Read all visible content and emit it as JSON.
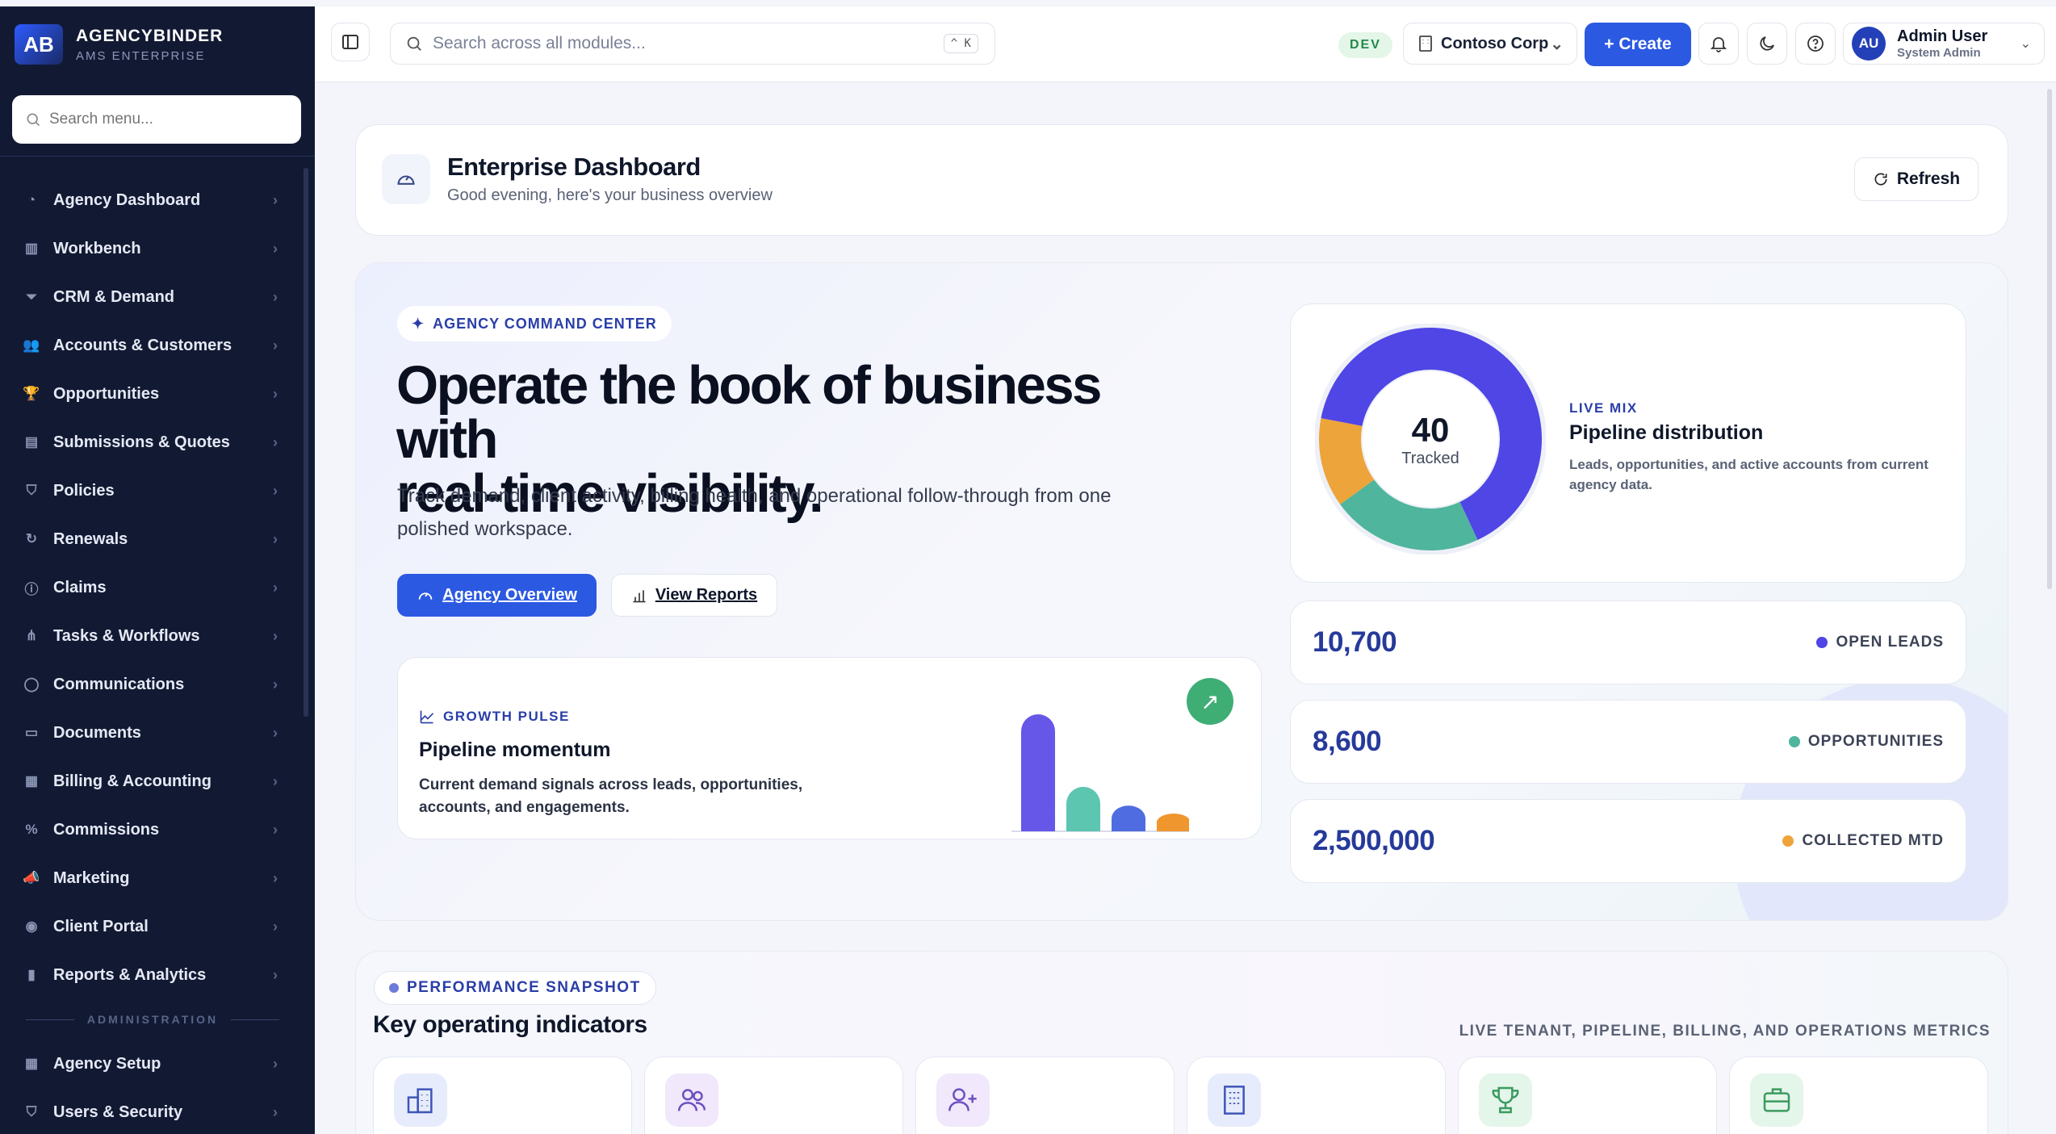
{
  "brand": {
    "name": "AGENCYBINDER",
    "sub": "AMS ENTERPRISE",
    "logo_text": "AB"
  },
  "sidebar": {
    "search_placeholder": "Search menu...",
    "items": [
      {
        "label": "Agency Dashboard",
        "icon": "gauge-icon"
      },
      {
        "label": "Workbench",
        "icon": "layout-icon"
      },
      {
        "label": "CRM & Demand",
        "icon": "funnel-icon"
      },
      {
        "label": "Accounts & Customers",
        "icon": "users-icon"
      },
      {
        "label": "Opportunities",
        "icon": "trophy-icon"
      },
      {
        "label": "Submissions & Quotes",
        "icon": "file-icon"
      },
      {
        "label": "Policies",
        "icon": "shield-icon"
      },
      {
        "label": "Renewals",
        "icon": "refresh-icon"
      },
      {
        "label": "Claims",
        "icon": "alert-icon"
      },
      {
        "label": "Tasks & Workflows",
        "icon": "workflow-icon"
      },
      {
        "label": "Communications",
        "icon": "message-icon"
      },
      {
        "label": "Documents",
        "icon": "folder-icon"
      },
      {
        "label": "Billing & Accounting",
        "icon": "ledger-icon"
      },
      {
        "label": "Commissions",
        "icon": "percent-icon"
      },
      {
        "label": "Marketing",
        "icon": "megaphone-icon"
      },
      {
        "label": "Client Portal",
        "icon": "user-circle-icon"
      },
      {
        "label": "Reports & Analytics",
        "icon": "bar-chart-icon"
      }
    ],
    "admin_label": "ADMINISTRATION",
    "admin_items": [
      {
        "label": "Agency Setup",
        "icon": "building-icon"
      },
      {
        "label": "Users & Security",
        "icon": "shield-user-icon"
      }
    ]
  },
  "topbar": {
    "search_placeholder": "Search across all modules...",
    "shortcut": "^ K",
    "env": "DEV",
    "tenant": "Contoso Corp",
    "create_label": "+ Create",
    "user": {
      "initials": "AU",
      "name": "Admin User",
      "role": "System Admin"
    }
  },
  "header": {
    "title": "Enterprise Dashboard",
    "subtitle": "Good evening, here's your business overview",
    "refresh_label": "Refresh"
  },
  "hero": {
    "pill": "AGENCY COMMAND CENTER",
    "headline_1": "Operate the book of business with",
    "headline_2": "real-time visibility.",
    "description": "Track demand, client activity, billing health, and operational follow-through from one polished workspace.",
    "primary_label": "Agency Overview",
    "secondary_label": "View Reports"
  },
  "growth": {
    "kicker": "GROWTH PULSE",
    "title": "Pipeline momentum",
    "description": "Current demand signals across leads, opportunities, accounts, and engagements.",
    "bars": [
      {
        "value": 1.0,
        "color": "#6657e8"
      },
      {
        "value": 0.38,
        "color": "#5cc6b0"
      },
      {
        "value": 0.22,
        "color": "#4f6de0"
      },
      {
        "value": 0.14,
        "color": "#f0962e"
      }
    ]
  },
  "distribution": {
    "total": "40",
    "total_label": "Tracked",
    "kicker": "LIVE MIX",
    "title": "Pipeline distribution",
    "description": "Leads, opportunities, and active accounts from current agency data.",
    "segments": [
      {
        "fraction": 0.65,
        "color": "#4f46e5"
      },
      {
        "fraction": 0.22,
        "color": "#4fb59d"
      },
      {
        "fraction": 0.13,
        "color": "#eda43a"
      }
    ]
  },
  "stats": [
    {
      "value": "10,700",
      "label": "OPEN LEADS",
      "color": "#4f46e5"
    },
    {
      "value": "8,600",
      "label": "OPPORTUNITIES",
      "color": "#4fb59d"
    },
    {
      "value": "2,500,000",
      "label": "COLLECTED MTD",
      "color": "#eda43a"
    }
  ],
  "performance": {
    "pill": "PERFORMANCE SNAPSHOT",
    "title": "Key operating indicators",
    "right_label": "LIVE TENANT, PIPELINE, BILLING, AND OPERATIONS METRICS",
    "cards": [
      {
        "icon": "city-icon",
        "color": "#e6ecfb"
      },
      {
        "icon": "users-icon",
        "color": "#f1e8fb"
      },
      {
        "icon": "user-plus-icon",
        "color": "#f1e8fb"
      },
      {
        "icon": "building-icon",
        "color": "#e6ecfb"
      },
      {
        "icon": "trophy-icon",
        "color": "#e4f5ea"
      },
      {
        "icon": "briefcase-icon",
        "color": "#e4f5ea"
      }
    ]
  }
}
